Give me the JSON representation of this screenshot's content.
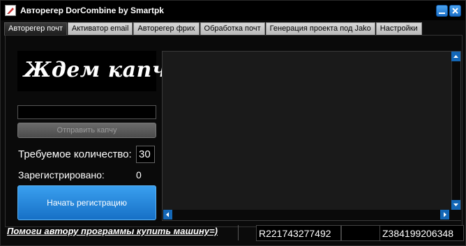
{
  "window": {
    "title": "Авторегер DorCombine by Smartpk",
    "accent": "#1b7ed6"
  },
  "tabs": [
    {
      "label": "Авторегер почт",
      "active": true
    },
    {
      "label": "Активатор email",
      "active": false
    },
    {
      "label": "Авторегер фрих",
      "active": false
    },
    {
      "label": "Обработка почт",
      "active": false
    },
    {
      "label": "Генерация проекта под Jako",
      "active": false
    },
    {
      "label": "Настройки",
      "active": false
    }
  ],
  "captcha": {
    "image_text": "Ждем капчу...",
    "input_value": "",
    "send_label": "Отправить капчу"
  },
  "form": {
    "required_label": "Требуемое количество:",
    "required_value": "30",
    "registered_label": "Зарегистрировано:",
    "registered_value": "0",
    "start_label": "Начать регистрацию"
  },
  "footer": {
    "link_text": "Помоги автору программы купить машину=)",
    "wallet_r": "R221743277492",
    "wallet_mid": "",
    "wallet_z": "Z384199206348"
  },
  "icons": {
    "app": "pen-icon",
    "minimize": "minimize-icon",
    "close": "close-icon"
  }
}
